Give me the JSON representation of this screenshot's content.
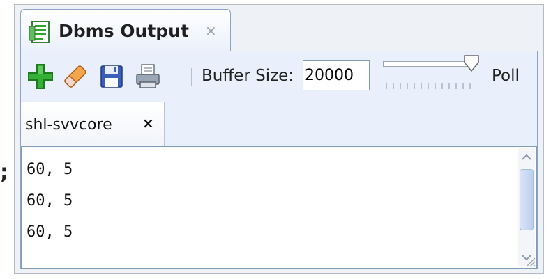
{
  "panel": {
    "title": "Dbms Output",
    "close_glyph": "×",
    "tab_icon": "dbms-output-icon"
  },
  "toolbar": {
    "buttons": [
      {
        "name": "enable-dbms-output-button",
        "icon": "plus-icon"
      },
      {
        "name": "clear-button",
        "icon": "eraser-icon"
      },
      {
        "name": "save-button",
        "icon": "disk-icon"
      },
      {
        "name": "print-button",
        "icon": "printer-icon"
      }
    ],
    "buffer_label": "Buffer Size:",
    "buffer_value": "20000",
    "poll_label": "Poll"
  },
  "connection_tab": {
    "label": "shl-svvcore",
    "close_glyph": "×"
  },
  "output": {
    "lines": [
      "60, 5",
      "60, 5",
      "60, 5"
    ]
  },
  "side_glyph": ";",
  "colors": {
    "accent_green": "#2fa52f",
    "tab_border": "#8da2c7",
    "panel_bg": "#eaf0fb"
  }
}
